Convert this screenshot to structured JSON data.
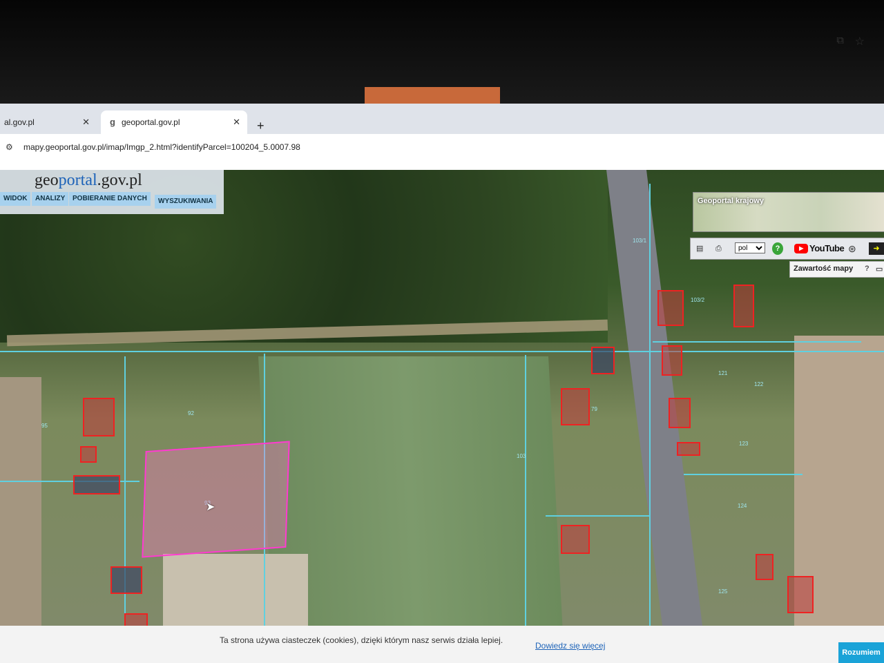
{
  "browser": {
    "tabs": [
      {
        "title": "al.gov.pl"
      },
      {
        "title": "geoportal.gov.pl"
      }
    ],
    "favicon_glyph": "g",
    "new_tab": "+",
    "close_glyph": "✕",
    "url": "mapy.geoportal.gov.pl/imap/Imgp_2.html?identifyParcel=100204_5.0007.98"
  },
  "header": {
    "logo_g": "g",
    "logo_eo": "eo",
    "logo_portal": "portal",
    "logo_tld": ".gov.pl",
    "menu": [
      "WIDOK",
      "ANALIZY",
      "POBIERANIE DANYCH",
      "WYSZUKIWANIA"
    ]
  },
  "overview": {
    "title": "Geoportal krajowy"
  },
  "toolbar": {
    "language": "pol",
    "help": "?",
    "youtube_label": "YouTube"
  },
  "content_panel": {
    "label": "Zawartość mapy",
    "help": "?"
  },
  "parcel_labels": [
    "95",
    "92",
    "93",
    "103",
    "103/1",
    "103/2",
    "79",
    "121",
    "122",
    "123",
    "124",
    "125"
  ],
  "cookie": {
    "text": "Ta strona używa ciasteczek (cookies), dzięki którym nasz serwis działa lepiej.",
    "link": "Dowiedz się więcej",
    "accept": "Rozumiem"
  },
  "colors": {
    "selection": "#ff3ad0",
    "buildings": "#e22222",
    "parcel_lines": "#5fd0e0",
    "menu": "#a7d1ee"
  }
}
